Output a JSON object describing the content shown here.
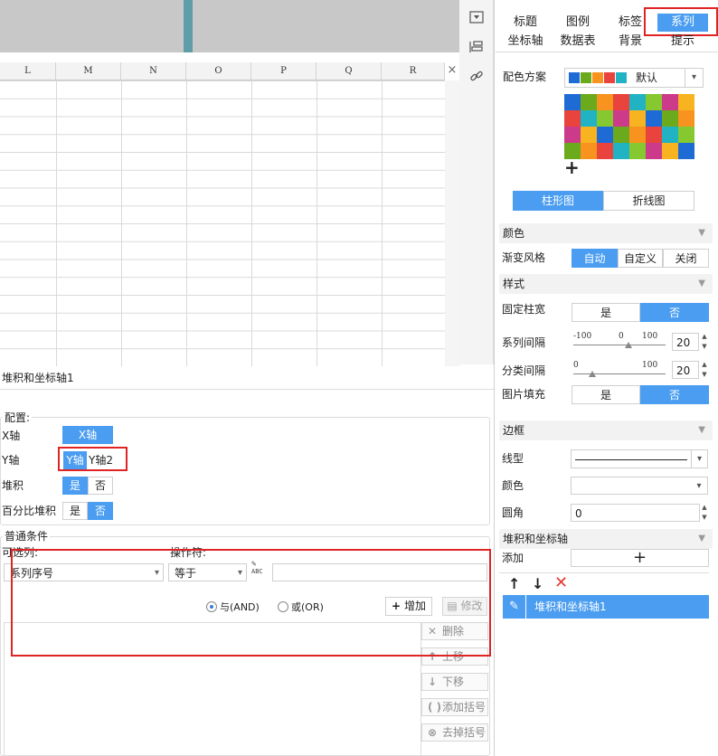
{
  "sheet": {
    "columns": [
      "L",
      "M",
      "N",
      "O",
      "P",
      "Q",
      "R"
    ],
    "close_symbol": "×"
  },
  "side_icons": [
    "dropdown-box-icon",
    "layers-icon",
    "link-icon"
  ],
  "tabs_row1": [
    "标题",
    "图例",
    "标签",
    "系列"
  ],
  "tabs_row2": [
    "坐标轴",
    "数据表",
    "背景",
    "提示"
  ],
  "active_tab": "系列",
  "color_scheme": {
    "label": "配色方案",
    "value": "默认",
    "swatches": [
      "#1e6bd6",
      "#6aaa1c",
      "#f7931e",
      "#e8433d",
      "#21b3c4"
    ],
    "palette_colors": [
      "#1e6bd6",
      "#6aaa1c",
      "#f7931e",
      "#e8433d",
      "#21b3c4",
      "#86c82f",
      "#cc3a8a",
      "#f7b420"
    ],
    "add_symbol": "+"
  },
  "chart_type_toggle": {
    "bar": "柱形图",
    "line": "折线图",
    "active": "柱形图"
  },
  "color_section": {
    "title": "颜色",
    "gradient_label": "渐变风格",
    "options": [
      "自动",
      "自定义",
      "关闭"
    ],
    "active": "自动"
  },
  "style_section": {
    "title": "样式",
    "fixed_width_label": "固定柱宽",
    "fixed_width": {
      "yes": "是",
      "no": "否",
      "active": "否"
    },
    "series_gap_label": "系列间隔",
    "series_gap_ticks": [
      "-100",
      "0",
      "100"
    ],
    "series_gap_value": "20",
    "category_gap_label": "分类间隔",
    "category_gap_ticks": [
      "0",
      "100"
    ],
    "category_gap_value": "20",
    "image_fill_label": "图片填充",
    "image_fill": {
      "yes": "是",
      "no": "否",
      "active": "否"
    }
  },
  "border_section": {
    "title": "边框",
    "line_type_label": "线型",
    "color_label": "颜色",
    "radius_label": "圆角",
    "radius_value": "0"
  },
  "stack_axis_section": {
    "title": "堆积和坐标轴",
    "add_label": "添加",
    "add_symbol": "+",
    "item_name": "堆积和坐标轴1"
  },
  "config": {
    "title": "堆积和坐标轴1",
    "group_label": "配置:",
    "x_axis_label": "X轴",
    "x_axis_value": "X轴",
    "y_axis_label": "Y轴",
    "y_axis_options": [
      "Y轴",
      "Y轴2"
    ],
    "y_axis_active": "Y轴",
    "stack_label": "堆积",
    "stack": {
      "yes": "是",
      "no": "否",
      "active": "是"
    },
    "percent_label": "百分比堆积",
    "percent": {
      "yes": "是",
      "no": "否",
      "active": "否"
    }
  },
  "condition": {
    "group_label": "普通条件",
    "column_label": "可选列:",
    "operator_label": "操作符:",
    "column_value": "系列序号",
    "operator_value": "等于",
    "formula_icon": "ABC",
    "and_label": "与(AND)",
    "or_label": "或(OR)",
    "logic_active": "AND",
    "add_button": "增加",
    "modify_button": "修改",
    "delete_button": "删除",
    "move_up_button": "上移",
    "move_down_button": "下移",
    "add_bracket_button": "添加括号",
    "remove_bracket_button": "去掉括号"
  }
}
